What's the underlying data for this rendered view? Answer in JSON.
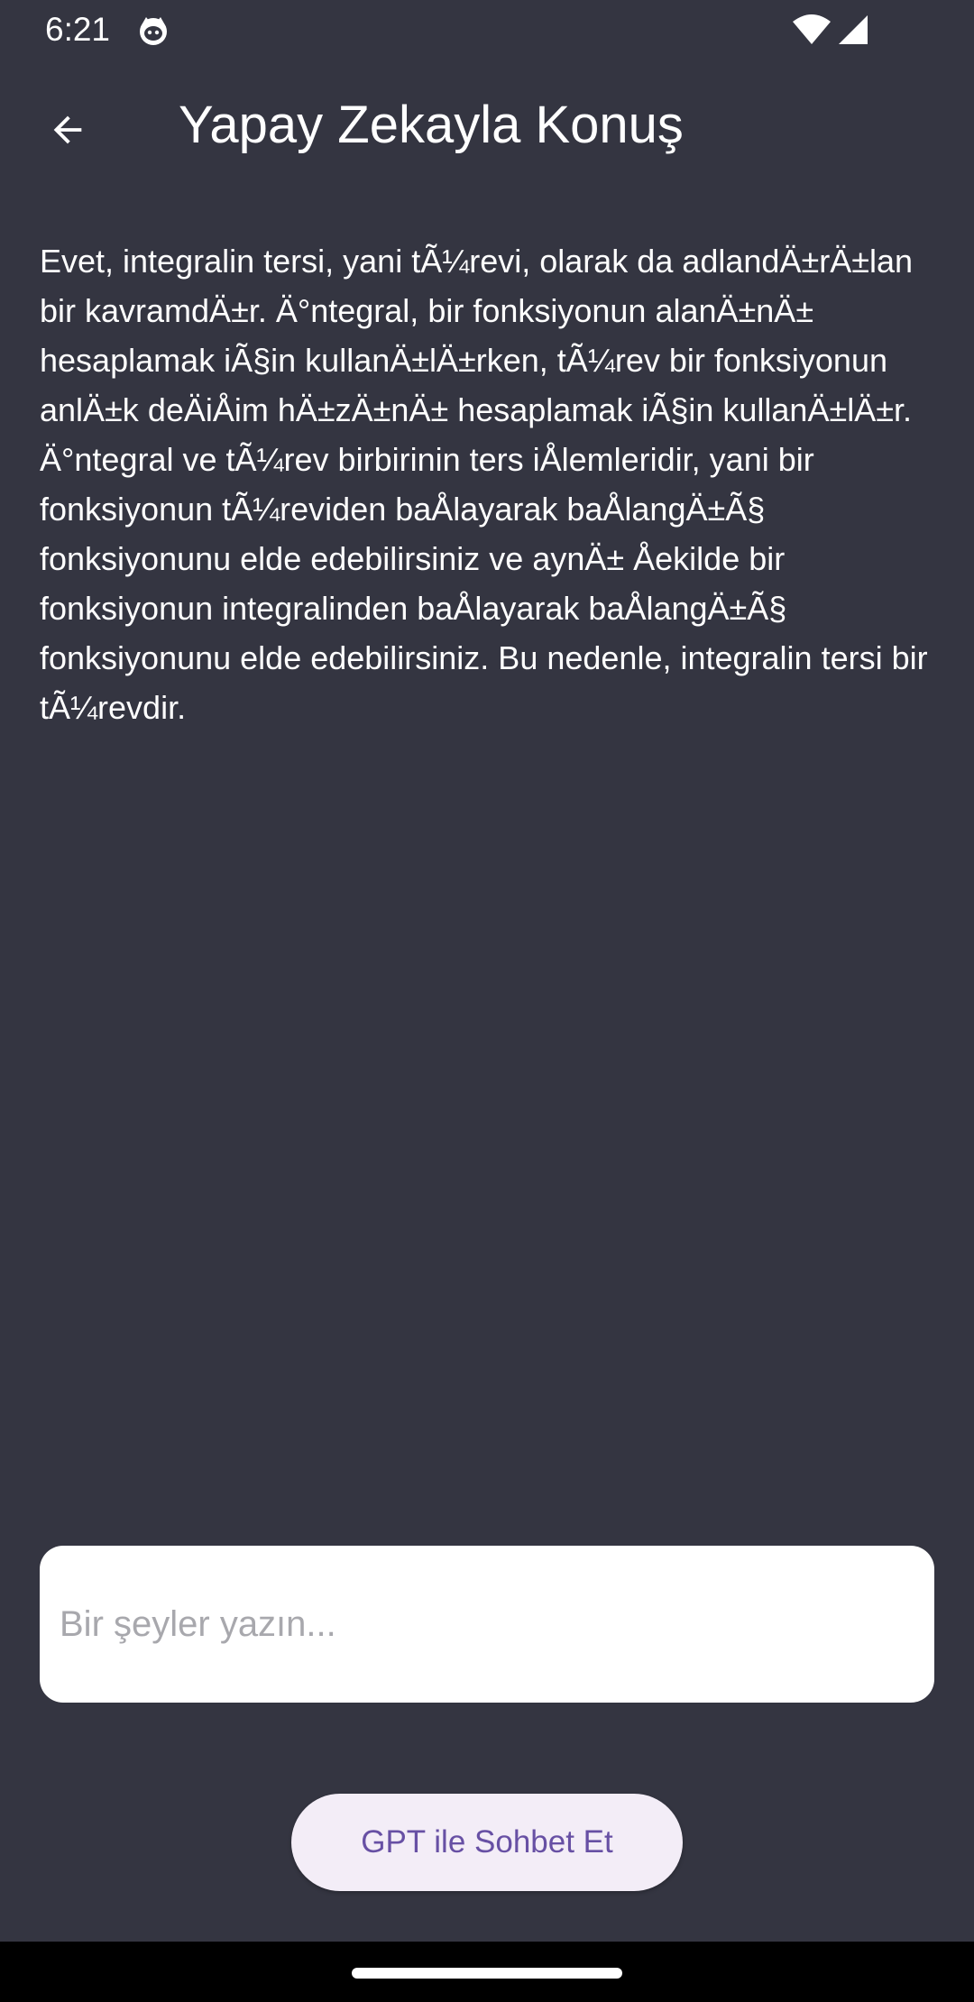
{
  "status_bar": {
    "time": "6:21",
    "icons": [
      "cat-icon",
      "wifi-icon",
      "cell-signal-icon"
    ]
  },
  "app_bar": {
    "back_icon": "arrow-left-icon",
    "title": "Yapay Zekayla Konuş"
  },
  "response": {
    "text": "Evet, integralin tersi, yani tÃ¼revi, olarak da adlandÄ±rÄ±lan bir kavramdÄ±r. Ä°ntegral, bir fonksiyonun alanÄ±nÄ± hesaplamak iÃ§in kullanÄ±lÄ±rken, tÃ¼rev bir fonksiyonun anlÄ±k deÄiÅim hÄ±zÄ±nÄ± hesaplamak iÃ§in kullanÄ±lÄ±r. Ä°ntegral ve tÃ¼rev birbirinin ters iÅlemleridir, yani bir fonksiyonun tÃ¼reviden baÅlayarak baÅlangÄ±Ã§ fonksiyonunu elde edebilirsiniz ve aynÄ± Åekilde bir fonksiyonun integralinden baÅlayarak baÅlangÄ±Ã§ fonksiyonunu elde edebilirsiniz. Bu nedenle, integralin tersi bir tÃ¼revdir."
  },
  "input": {
    "value": "",
    "placeholder": "Bir şeyler yazın..."
  },
  "chat_button": {
    "label": "GPT ile Sohbet Et"
  },
  "colors": {
    "background": "#343541",
    "button_bg": "#f3edf7",
    "button_text": "#6750a4",
    "placeholder": "#a8a8ad"
  }
}
